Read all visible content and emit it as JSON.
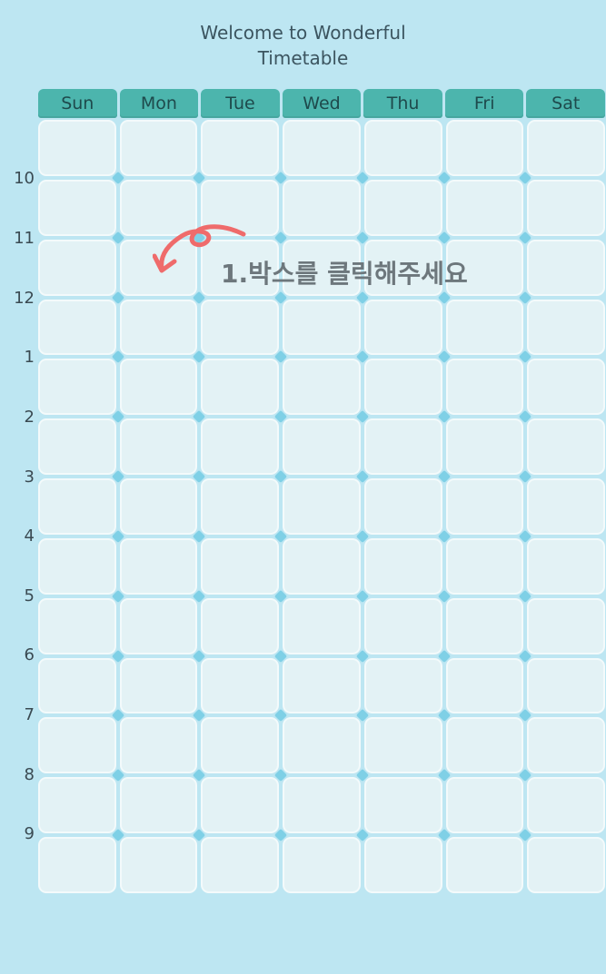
{
  "title": {
    "line1": "Welcome to Wonderful",
    "line2": "Timetable"
  },
  "days": [
    "Sun",
    "Mon",
    "Tue",
    "Wed",
    "Thu",
    "Fri",
    "Sat"
  ],
  "hours": [
    "10",
    "11",
    "12",
    "1",
    "2",
    "3",
    "4",
    "5",
    "6",
    "7",
    "8",
    "9"
  ],
  "hint": {
    "text": "1.박스를 클릭해주세요"
  },
  "colors": {
    "background": "#bde6f2",
    "header": "#4cb5ad",
    "cell": "#e3f2f5",
    "accent_dot": "#7fd0e6",
    "arrow": "#ef6b6b"
  },
  "icons": {
    "hint_arrow": "curved-arrow-icon"
  }
}
